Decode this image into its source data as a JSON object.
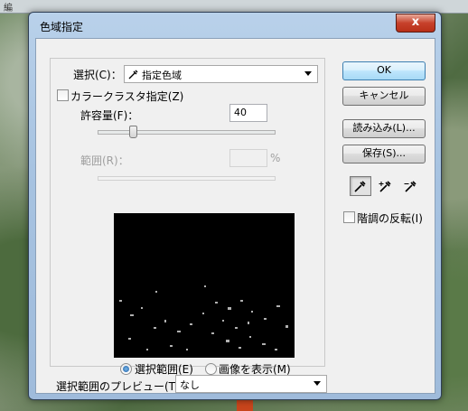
{
  "background": {
    "strip_text": "編"
  },
  "dialog": {
    "title": "色域指定",
    "close_glyph": "x",
    "select": {
      "label": "選択(C)：",
      "value": "指定色域"
    },
    "localized_color_clusters": {
      "label": "カラークラスタ指定(Z)",
      "checked": false
    },
    "fuzziness": {
      "label": "許容量(F)：",
      "value": "40",
      "slider_fraction": 0.2
    },
    "range": {
      "label": "範囲(R)：",
      "value": "",
      "unit": "%",
      "disabled": true
    },
    "preview_mode": {
      "selection_label": "選択範囲(E)",
      "image_label": "画像を表示(M)",
      "selected": "selection"
    },
    "selection_preview": {
      "label": "選択範囲のプレビュー(T)：",
      "value": "なし"
    },
    "buttons": {
      "ok": "OK",
      "cancel": "キャンセル",
      "load": "読み込み(L)...",
      "save": "保存(S)..."
    },
    "invert": {
      "label": "階調の反転(I)",
      "checked": false
    },
    "tools": {
      "eyedropper": "eyedropper-icon",
      "add_eyedropper": "eyedropper-plus-icon",
      "subtract_eyedropper": "eyedropper-minus-icon"
    }
  }
}
